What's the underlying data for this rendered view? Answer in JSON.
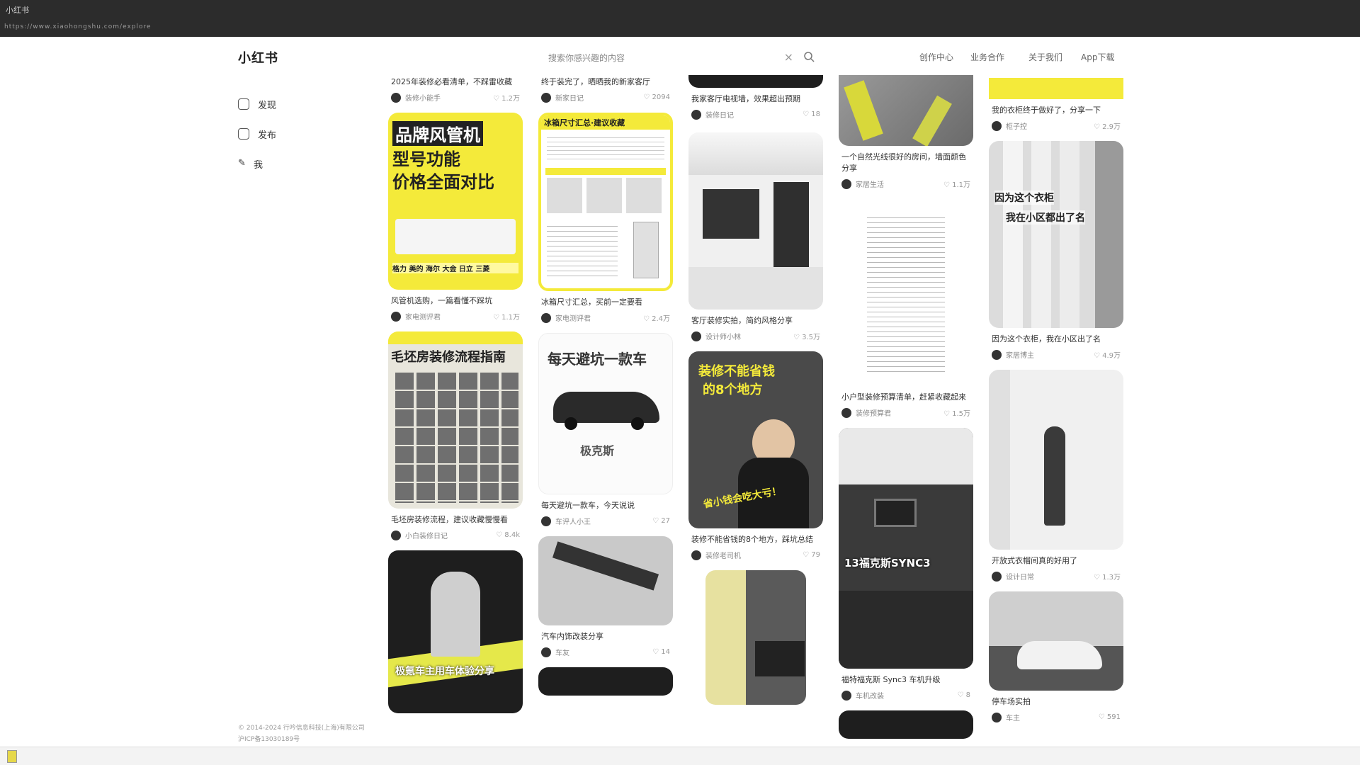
{
  "browser": {
    "tab_title": "小红书",
    "url": "https://www.xiaohongshu.com/explore"
  },
  "header": {
    "logo": "小红书",
    "search_placeholder": "搜索你感兴趣的内容",
    "nav": [
      "创作中心",
      "业务合作",
      "关于我们",
      "App下载"
    ]
  },
  "sidebar": {
    "items": [
      {
        "label": "发现",
        "icon": "home-icon"
      },
      {
        "label": "发布",
        "icon": "plus-square-icon"
      },
      {
        "label": "我",
        "icon": "user-icon"
      }
    ],
    "footer": [
      "© 2014-2024 行吟信息科技(上海)有限公司",
      "沪ICP备13030189号"
    ]
  },
  "feed": {
    "col1": [
      {
        "title": "2025年装修必看清单，不踩雷收藏",
        "user": "装修小能手",
        "likes": "1.2万",
        "snippet": true
      },
      {
        "title": "风管机选购，一篇看懂不踩坑",
        "user": "家电测评君",
        "likes": "1.1万",
        "overlay": [
          "品牌风管机",
          "型号功能",
          "价格全面对比"
        ],
        "banner": "格力 美的 海尔 大金 日立 三菱"
      },
      {
        "title": "毛坯房装修流程，建议收藏慢慢看",
        "user": "小白装修日记",
        "likes": "8.4k",
        "overlay": [
          "毛坯房装修流程指南"
        ]
      },
      {
        "title": "",
        "user": "",
        "likes": "",
        "overlay": [
          "极氪车主用车体验分享"
        ]
      }
    ],
    "col2": [
      {
        "title": "终于装完了，晒晒我的新家客厅",
        "user": "新家日记",
        "likes": "2094",
        "snippet": true
      },
      {
        "title": "冰箱尺寸汇总，买前一定要看",
        "user": "家电测评君",
        "likes": "2.4万",
        "overlay": [
          "冰箱尺寸汇总·建议收藏"
        ]
      },
      {
        "title": "每天避坑一款车，今天说说",
        "user": "车评人小王",
        "likes": "27",
        "overlay": [
          "每天避坑一款车",
          "极克斯"
        ]
      },
      {
        "title": "汽车内饰改装分享",
        "user": "车友",
        "likes": "14"
      }
    ],
    "col3": [
      {
        "title": "我家客厅电视墙，效果超出预期",
        "user": "装修日记",
        "likes": "18",
        "snippet": true
      },
      {
        "title": "客厅装修实拍，简约风格分享",
        "user": "设计师小林",
        "likes": "3.5万"
      },
      {
        "title": "装修不能省钱的8个地方，踩坑总结",
        "user": "装修老司机",
        "likes": "79",
        "overlay": [
          "装修不能省钱",
          "的8个地方",
          "省小钱会吃大亏！"
        ]
      },
      {
        "title": "",
        "user": "",
        "likes": ""
      }
    ],
    "col4": [
      {
        "title": "一个自然光线很好的房间，墙面颜色分享",
        "user": "家居生活",
        "likes": "1.1万"
      },
      {
        "title": "小户型装修预算清单，赶紧收藏起来",
        "user": "装修预算君",
        "likes": "1.5万",
        "doc": true
      },
      {
        "title": "福特福克斯 Sync3 车机升级",
        "user": "车机改装",
        "likes": "8",
        "overlay": [
          "13福克斯SYNC3"
        ]
      },
      {
        "title": "",
        "user": "",
        "likes": ""
      }
    ],
    "col5": [
      {
        "title": "我的衣柜终于做好了，分享一下",
        "user": "柜子控",
        "likes": "2.9万",
        "snippet": true
      },
      {
        "title": "因为这个衣柜，我在小区出了名",
        "user": "家居博主",
        "likes": "4.9万",
        "overlay": [
          "因为这个衣柜",
          "我在小区都出了名"
        ]
      },
      {
        "title": "开放式衣帽间真的好用了",
        "user": "设计日常",
        "likes": "1.3万"
      },
      {
        "title": "停车场实拍",
        "user": "车主",
        "likes": "591"
      }
    ]
  }
}
